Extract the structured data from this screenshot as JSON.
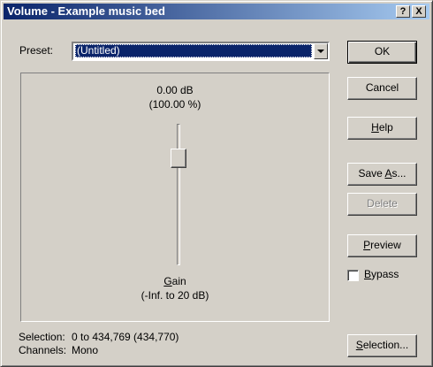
{
  "window": {
    "title": "Volume - Example music bed",
    "help_glyph": "?",
    "close_glyph": "X"
  },
  "preset": {
    "label": "Preset:",
    "value": "(Untitled)"
  },
  "gain": {
    "db_readout": "0.00 dB",
    "percent_readout": "(100.00 %)",
    "label_hotkey": "G",
    "label_rest": "ain",
    "range_label": "(-Inf. to 20 dB)",
    "slider_level": 0.8
  },
  "buttons": {
    "ok": "OK",
    "cancel": "Cancel",
    "help_hotkey": "H",
    "help_rest": "elp",
    "save_as_pre": "Save ",
    "save_as_hotkey": "A",
    "save_as_post": "s...",
    "delete": "Delete",
    "preview_hotkey": "P",
    "preview_rest": "review",
    "selection_hotkey": "S",
    "selection_rest": "election..."
  },
  "bypass": {
    "hotkey": "B",
    "rest": "ypass",
    "checked": false
  },
  "status": {
    "selection_label": "Selection:",
    "selection_value": "0 to 434,769 (434,770)",
    "channels_label": "Channels:",
    "channels_value": "Mono"
  },
  "colors": {
    "face": "#d4d0c8",
    "title_active": "#0a246a",
    "title_gradient_end": "#a6caf0",
    "selection_highlight": "#0a246a"
  }
}
